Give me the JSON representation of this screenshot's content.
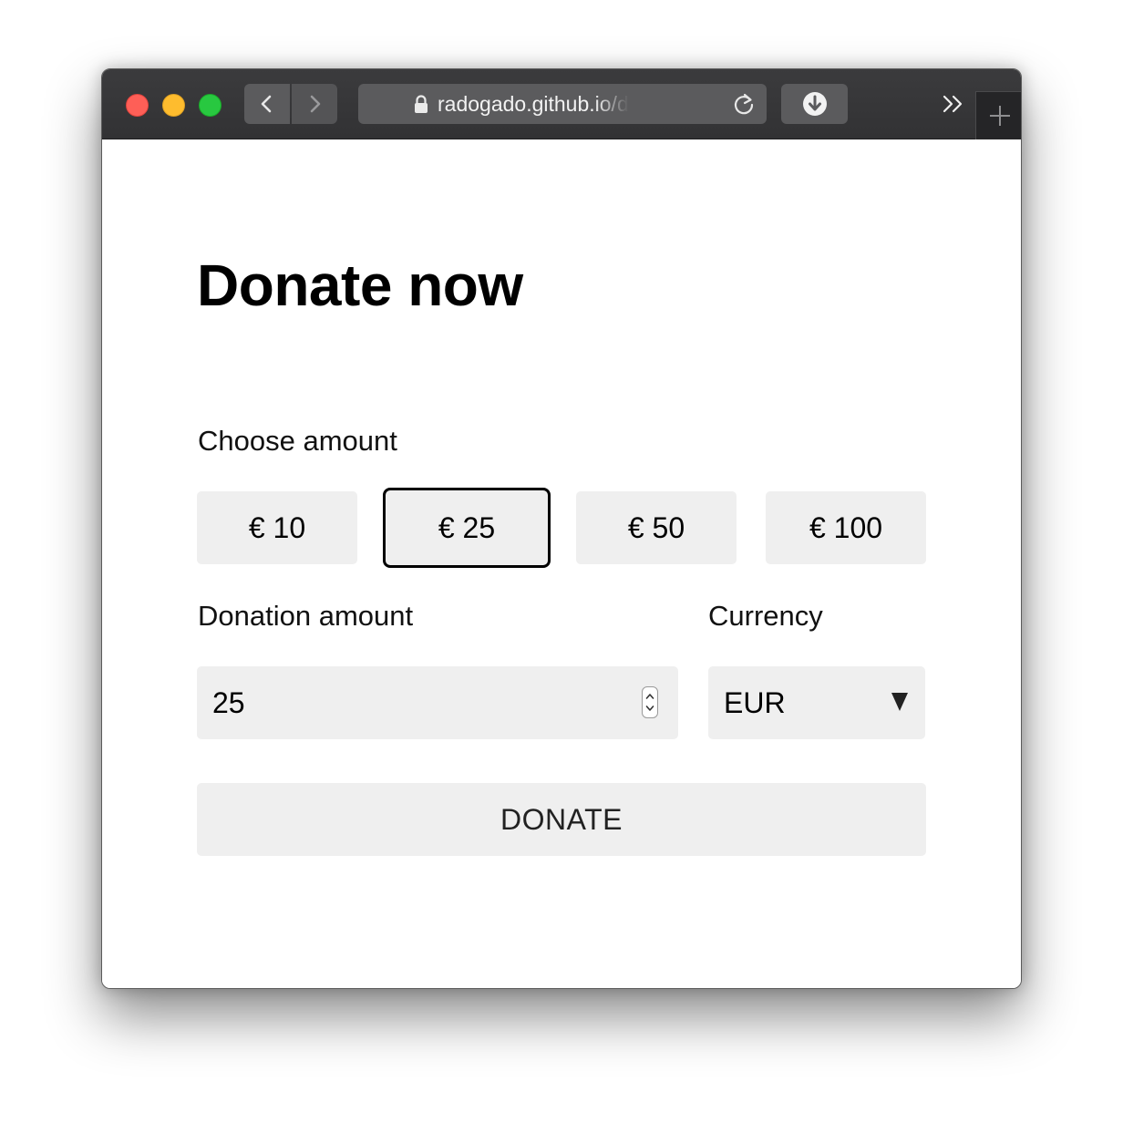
{
  "browser": {
    "url": "radogado.github.io/donati"
  },
  "page": {
    "heading": "Donate now",
    "choose_label": "Choose amount",
    "amount_options": [
      "€ 10",
      "€ 25",
      "€ 50",
      "€ 100"
    ],
    "selected_option": "€ 25",
    "donation_amount_label": "Donation amount",
    "donation_amount_value": "25",
    "currency_label": "Currency",
    "currency_value": "EUR",
    "donate_button": "DONATE"
  },
  "colors": {
    "titlebar": "#38383a",
    "field_bg": "#efefef",
    "selected_border": "#000000"
  }
}
